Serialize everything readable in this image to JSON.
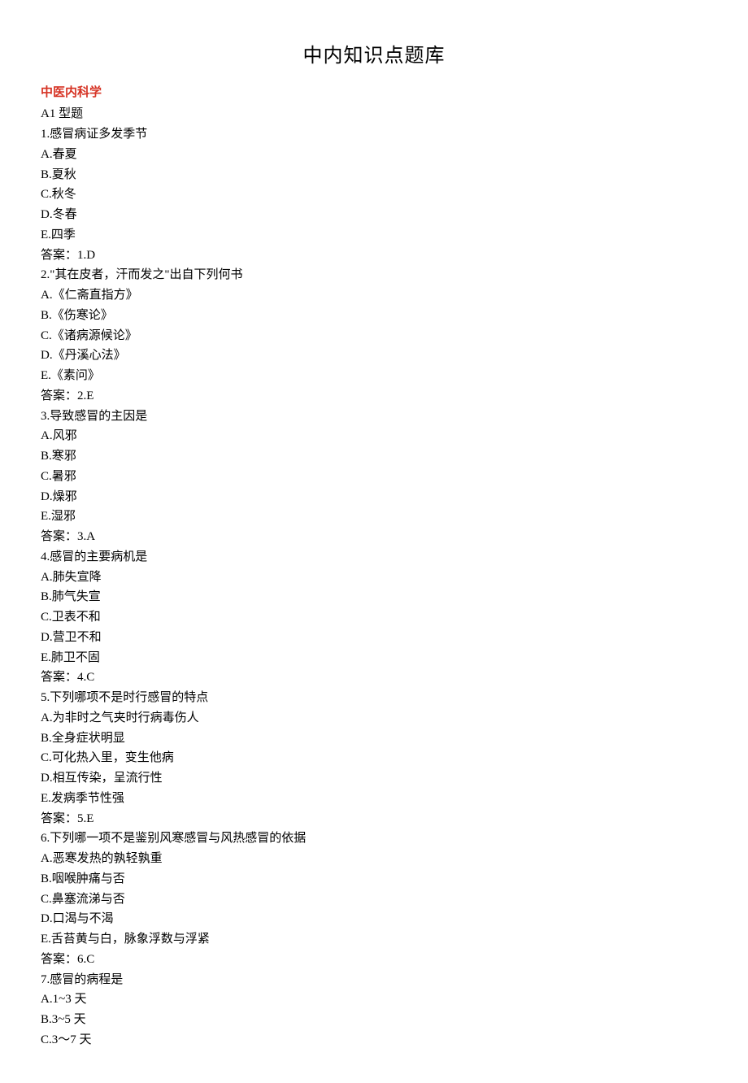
{
  "title": "中内知识点题库",
  "section_header": "中医内科学",
  "lines": [
    "A1 型题",
    "1.感冒病证多发季节",
    "A.春夏",
    "B.夏秋",
    "C.秋冬",
    "D.冬春",
    "E.四季",
    "答案：1.D",
    "2.\"其在皮者，汗而发之\"出自下列何书",
    "A.《仁斋直指方》",
    "B.《伤寒论》",
    "C.《诸病源候论》",
    "D.《丹溪心法》",
    "E.《素问》",
    "答案：2.E",
    "3.导致感冒的主因是",
    "A.风邪",
    "B.寒邪",
    "C.暑邪",
    "D.燥邪",
    "E.湿邪",
    "答案：3.A",
    "4.感冒的主要病机是",
    "A.肺失宣降",
    "B.肺气失宣",
    "C.卫表不和",
    "D.营卫不和",
    "E.肺卫不固",
    "答案：4.C",
    "5.下列哪项不是时行感冒的特点",
    "A.为非时之气夹时行病毒伤人",
    "B.全身症状明显",
    "C.可化热入里，变生他病",
    "D.相互传染，呈流行性",
    "E.发病季节性强",
    "答案：5.E",
    "6.下列哪一项不是鉴别风寒感冒与风热感冒的依据",
    "A.恶寒发热的孰轻孰重",
    "B.咽喉肿痛与否",
    "C.鼻塞流涕与否",
    "D.口渴与不渴",
    "E.舌苔黄与白，脉象浮数与浮紧",
    "答案：6.C",
    "7.感冒的病程是",
    "A.1~3 天",
    "B.3~5 天",
    "C.3～7 天"
  ]
}
